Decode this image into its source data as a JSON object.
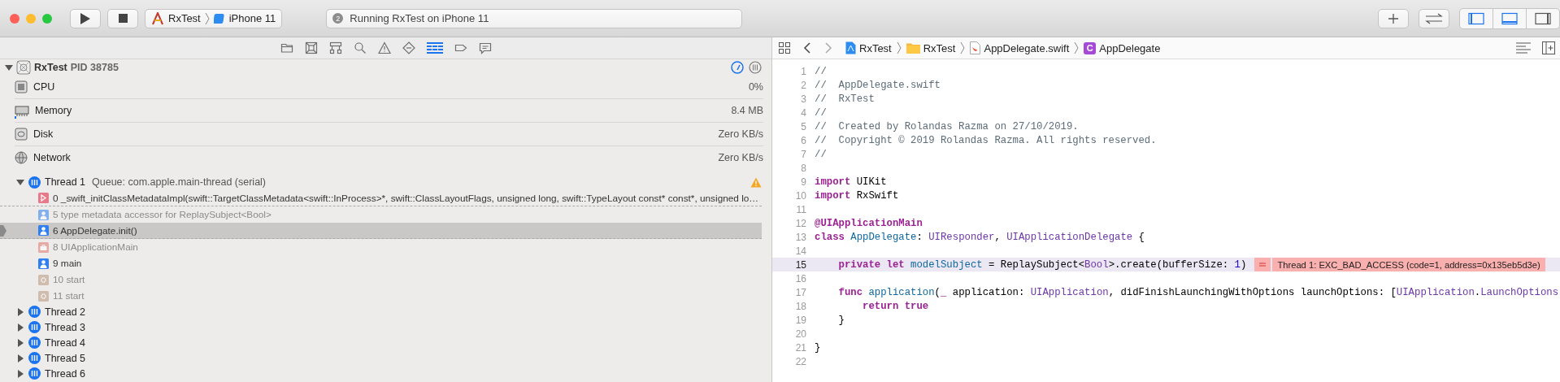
{
  "toolbar": {
    "scheme": "RxTest",
    "device": "iPhone 11",
    "activity": {
      "badge": "2",
      "text": "Running RxTest on iPhone 11"
    },
    "panel_toggles": [
      {
        "kind": "left",
        "on": true
      },
      {
        "kind": "bottom",
        "on": true
      },
      {
        "kind": "right",
        "on": false
      }
    ]
  },
  "navigator_tabs": [
    {
      "kind": "folder",
      "selected": false
    },
    {
      "kind": "source-control",
      "selected": false
    },
    {
      "kind": "hierarchy",
      "selected": false
    },
    {
      "kind": "search",
      "selected": false
    },
    {
      "kind": "warning",
      "selected": false
    },
    {
      "kind": "test",
      "selected": false
    },
    {
      "kind": "debug",
      "selected": true
    },
    {
      "kind": "breakpoint",
      "selected": false
    },
    {
      "kind": "report",
      "selected": false
    }
  ],
  "debug_navigator": {
    "process": {
      "name": "RxTest",
      "pid": "PID 38785"
    },
    "gauges": [
      {
        "kind": "cpu",
        "label": "CPU",
        "value": "0%"
      },
      {
        "kind": "memory",
        "label": "Memory",
        "value": "8.4 MB",
        "level": 0.002
      },
      {
        "kind": "disk",
        "label": "Disk",
        "value": "Zero KB/s"
      },
      {
        "kind": "network",
        "label": "Network",
        "value": "Zero KB/s"
      }
    ],
    "threads": [
      {
        "name": "Thread 1",
        "queue": "Queue: com.apple.main-thread (serial)",
        "expanded": true,
        "warning": true,
        "frames": [
          {
            "kind": "library",
            "label": "0 _swift_initClassMetadataImpl(swift::TargetClassMetadata<swift::InProcess>*, swift::ClassLayoutFlags, unsigned long, swift::TypeLayout const* const*, unsigned lo…",
            "dimmed": false,
            "selected": false,
            "gap_after": true
          },
          {
            "kind": "user",
            "label": "5 type metadata accessor for ReplaySubject<Bool>",
            "dimmed": true,
            "selected": false,
            "gap_after": false
          },
          {
            "kind": "user",
            "label": "6 AppDelegate.init()",
            "dimmed": false,
            "selected": true,
            "gap_after": true
          },
          {
            "kind": "framework",
            "label": "8 UIApplicationMain",
            "dimmed": true,
            "selected": false,
            "gap_after": false
          },
          {
            "kind": "user",
            "label": "9 main",
            "dimmed": false,
            "selected": false,
            "gap_after": false
          },
          {
            "kind": "system",
            "label": "10 start",
            "dimmed": true,
            "selected": false,
            "gap_after": false
          },
          {
            "kind": "system",
            "label": "11 start",
            "dimmed": true,
            "selected": false,
            "gap_after": false
          }
        ]
      },
      {
        "name": "Thread 2",
        "expanded": false,
        "warning": false
      },
      {
        "name": "Thread 3",
        "expanded": false,
        "warning": false
      },
      {
        "name": "Thread 4",
        "expanded": false,
        "warning": false
      },
      {
        "name": "Thread 5",
        "expanded": false,
        "warning": false
      },
      {
        "name": "Thread 6",
        "expanded": false,
        "warning": false
      }
    ]
  },
  "jump_bar": [
    {
      "kind": "project",
      "label": "RxTest"
    },
    {
      "kind": "folder",
      "label": "RxTest"
    },
    {
      "kind": "swift-file",
      "label": "AppDelegate.swift"
    },
    {
      "kind": "class",
      "badge": "C",
      "label": "AppDelegate"
    }
  ],
  "editor": {
    "lines": [
      {
        "number": "1",
        "tokens": [
          {
            "kind": "comment",
            "text": "//"
          }
        ]
      },
      {
        "number": "2",
        "tokens": [
          {
            "kind": "comment",
            "text": "//  AppDelegate.swift"
          }
        ]
      },
      {
        "number": "3",
        "tokens": [
          {
            "kind": "comment",
            "text": "//  RxTest"
          }
        ]
      },
      {
        "number": "4",
        "tokens": [
          {
            "kind": "comment",
            "text": "//"
          }
        ]
      },
      {
        "number": "5",
        "tokens": [
          {
            "kind": "comment",
            "text": "//  Created by Rolandas Razma on 27/10/2019."
          }
        ]
      },
      {
        "number": "6",
        "tokens": [
          {
            "kind": "comment",
            "text": "//  Copyright © 2019 Rolandas Razma. All rights reserved."
          }
        ]
      },
      {
        "number": "7",
        "tokens": [
          {
            "kind": "comment",
            "text": "//"
          }
        ]
      },
      {
        "number": "8"
      },
      {
        "number": "9",
        "tokens": [
          {
            "kind": "keyword",
            "text": "import"
          },
          {
            "kind": "plain",
            "text": " UIKit"
          }
        ]
      },
      {
        "number": "10",
        "tokens": [
          {
            "kind": "keyword",
            "text": "import"
          },
          {
            "kind": "plain",
            "text": " RxSwift"
          }
        ]
      },
      {
        "number": "11"
      },
      {
        "number": "12",
        "tokens": [
          {
            "kind": "keyword",
            "text": "@UIApplicationMain"
          }
        ]
      },
      {
        "number": "13",
        "tokens": [
          {
            "kind": "keyword",
            "text": "class"
          },
          {
            "kind": "declaration",
            "text": " AppDelegate"
          },
          {
            "kind": "plain",
            "text": ": "
          },
          {
            "kind": "type",
            "text": "UIResponder"
          },
          {
            "kind": "plain",
            "text": ", "
          },
          {
            "kind": "type",
            "text": "UIApplicationDelegate"
          },
          {
            "kind": "plain",
            "text": " {"
          }
        ]
      },
      {
        "number": "14"
      },
      {
        "number": "15",
        "current": true,
        "error": "Thread 1: EXC_BAD_ACCESS (code=1, address=0x135eb5d3e)",
        "tokens": [
          {
            "kind": "keyword",
            "text": "    private"
          },
          {
            "kind": "keyword",
            "text": " let"
          },
          {
            "kind": "declaration",
            "text": " modelSubject"
          },
          {
            "kind": "plain",
            "text": " = ReplaySubject<"
          },
          {
            "kind": "type",
            "text": "Bool"
          },
          {
            "kind": "plain",
            "text": ">.create(bufferSize: "
          },
          {
            "kind": "number",
            "text": "1"
          },
          {
            "kind": "plain",
            "text": ")"
          }
        ]
      },
      {
        "number": "16"
      },
      {
        "number": "17",
        "tokens": [
          {
            "kind": "keyword",
            "text": "    func"
          },
          {
            "kind": "declaration",
            "text": " application"
          },
          {
            "kind": "plain",
            "text": "("
          },
          {
            "kind": "keyword",
            "text": "_"
          },
          {
            "kind": "plain",
            "text": " application: "
          },
          {
            "kind": "type",
            "text": "UIApplication"
          },
          {
            "kind": "plain",
            "text": ", didFinishLaunchingWithOptions launchOptions: ["
          },
          {
            "kind": "type",
            "text": "UIApplication"
          },
          {
            "kind": "plain",
            "text": "."
          },
          {
            "kind": "type",
            "text": "LaunchOptions"
          }
        ]
      },
      {
        "number": "18",
        "tokens": [
          {
            "kind": "keyword",
            "text": "        return"
          },
          {
            "kind": "keyword",
            "text": " true"
          }
        ]
      },
      {
        "number": "19",
        "tokens": [
          {
            "kind": "plain",
            "text": "    }"
          }
        ]
      },
      {
        "number": "20"
      },
      {
        "number": "21",
        "tokens": [
          {
            "kind": "plain",
            "text": "}"
          }
        ]
      },
      {
        "number": "22"
      }
    ]
  }
}
